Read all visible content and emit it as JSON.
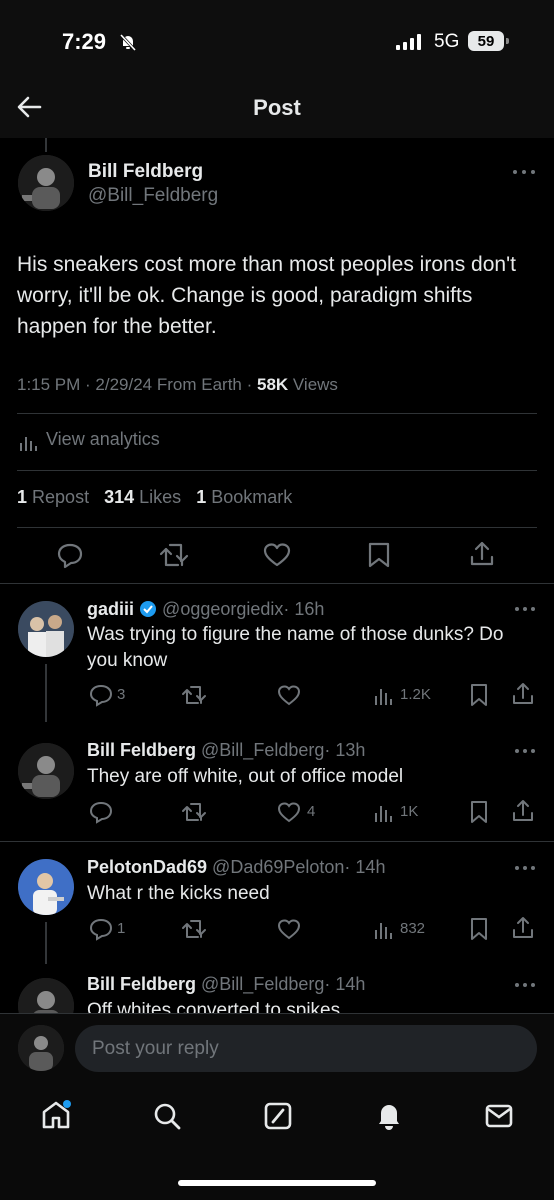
{
  "status": {
    "time": "7:29",
    "network": "5G",
    "battery": "59"
  },
  "header": {
    "title": "Post"
  },
  "tweet": {
    "author_name": "Bill Feldberg",
    "author_handle": "@Bill_Feldberg",
    "text": "His sneakers cost more than most peoples irons don't worry, it'll be ok. Change is good, paradigm shifts happen for the better.",
    "meta_time": "1:15 PM · 2/29/24 From Earth · ",
    "meta_views_count": "58K",
    "meta_views_label": " Views",
    "analytics_label": "View analytics",
    "reposts_count": "1",
    "reposts_label": "Repost",
    "likes_count": "314",
    "likes_label": "Likes",
    "bookmarks_count": "1",
    "bookmarks_label": "Bookmark"
  },
  "replies": [
    {
      "name": "gadiii",
      "verified": true,
      "handle": "@oggeorgiedix",
      "time": "· 16h",
      "text": "Was trying to figure the name of those dunks? Do you know",
      "replies": "3",
      "reposts": "",
      "likes": "",
      "views": "1.2K"
    },
    {
      "name": "Bill Feldberg",
      "handle": "@Bill_Feldberg",
      "time": "· 13h",
      "text": "They are off white, out of office model",
      "replies": "",
      "reposts": "",
      "likes": "4",
      "views": "1K"
    },
    {
      "name": "PelotonDad69",
      "handle": "@Dad69Peloton",
      "time": "· 14h",
      "text": "What r the kicks need",
      "replies": "1",
      "reposts": "",
      "likes": "",
      "views": "832"
    },
    {
      "name": "Bill Feldberg",
      "handle": "@Bill_Feldberg",
      "time": "· 14h",
      "text": "Off whites converted to spikes"
    }
  ],
  "composer": {
    "placeholder": "Post your reply"
  },
  "icons": {
    "back": "arrow-left-icon",
    "more": "more-horizontal-icon",
    "reply": "speech-bubble-icon",
    "repost": "repost-icon",
    "like": "heart-icon",
    "bookmark": "bookmark-icon",
    "share": "share-icon",
    "views": "bar-chart-icon",
    "home": "home-icon",
    "search": "search-icon",
    "grok": "slash-box-icon",
    "notifications": "bell-icon",
    "messages": "envelope-icon"
  },
  "colors": {
    "background": "#000000",
    "text": "#e7e9ea",
    "muted": "#71767b",
    "accent": "#1d9bf0"
  }
}
